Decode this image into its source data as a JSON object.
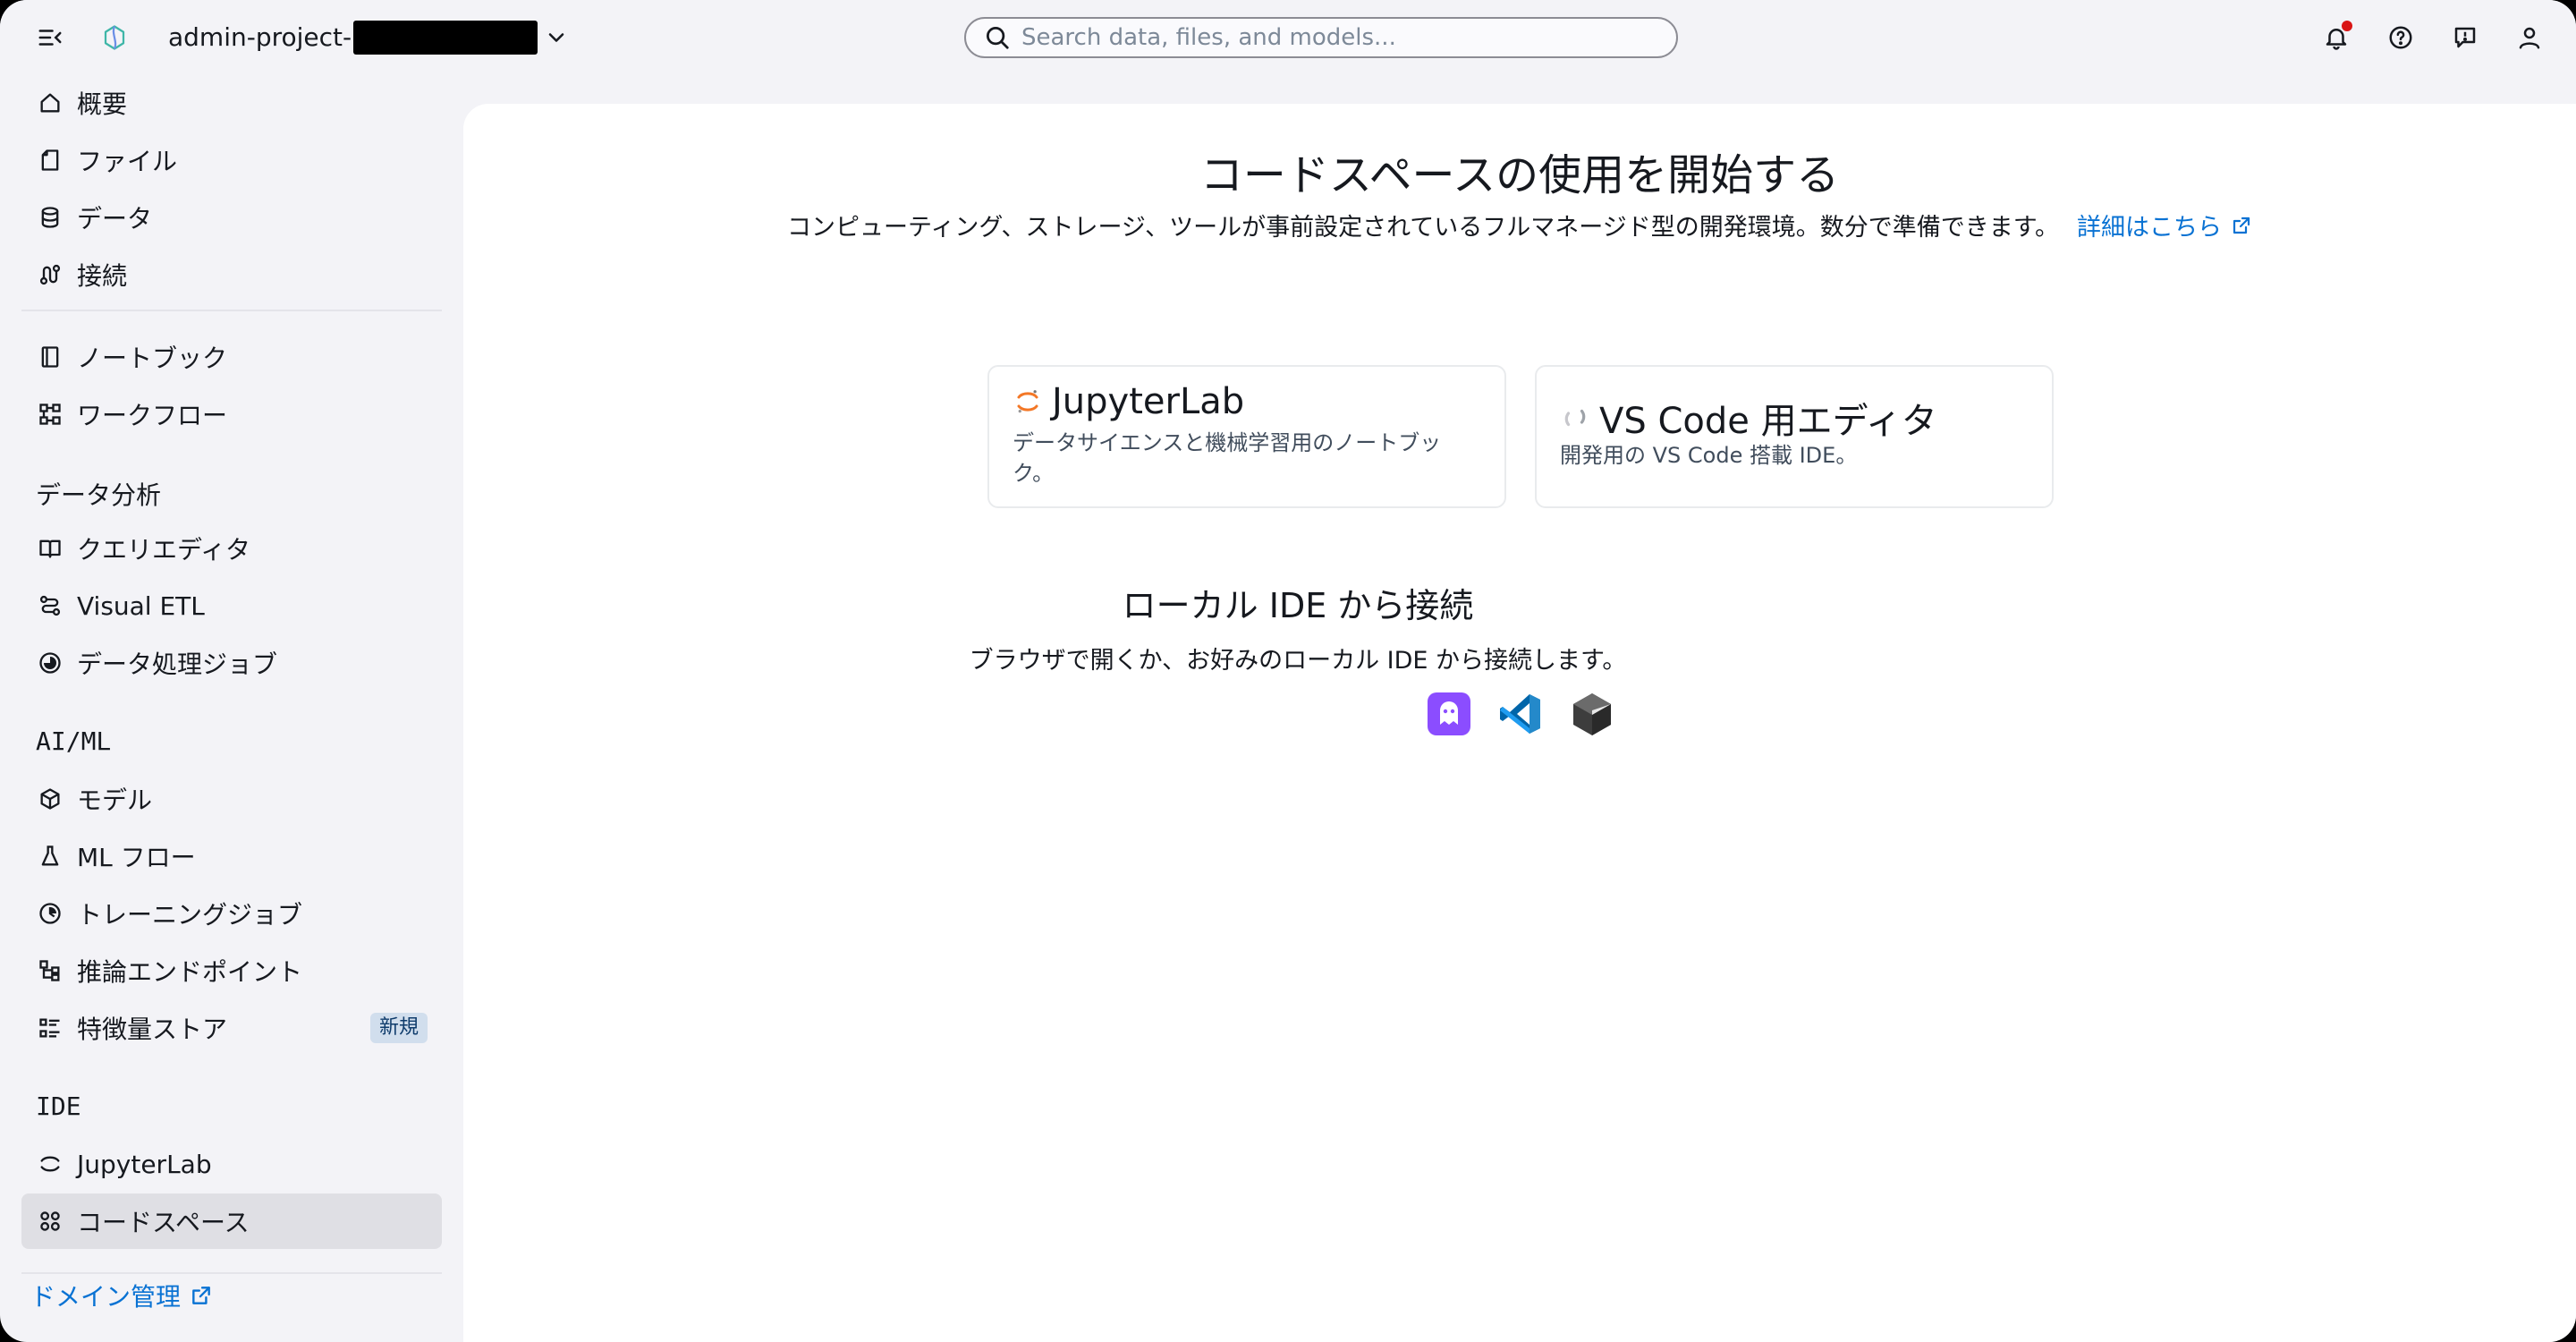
{
  "header": {
    "menu_icon": "collapse-menu-icon",
    "logo_icon": "studio-logo-icon",
    "project_name": "admin-project-",
    "search_placeholder": "Search data, files, and models...",
    "icons": [
      "bell-icon",
      "help-icon",
      "feedback-icon",
      "user-icon"
    ]
  },
  "sidebar": {
    "items_top": [
      {
        "label": "概要",
        "icon": "home-icon"
      },
      {
        "label": "ファイル",
        "icon": "file-icon"
      },
      {
        "label": "データ",
        "icon": "database-icon"
      },
      {
        "label": "接続",
        "icon": "connection-icon"
      }
    ],
    "items_build": [
      {
        "label": "ノートブック",
        "icon": "notebook-icon"
      },
      {
        "label": "ワークフロー",
        "icon": "workflow-icon"
      }
    ],
    "section_analytics": "データ分析",
    "items_analytics": [
      {
        "label": "クエリエディタ",
        "icon": "book-icon"
      },
      {
        "label": "Visual ETL",
        "icon": "etl-icon"
      },
      {
        "label": "データ処理ジョブ",
        "icon": "job-icon"
      }
    ],
    "section_aiml": "AI/ML",
    "items_aiml": [
      {
        "label": "モデル",
        "icon": "cube-icon"
      },
      {
        "label": "ML フロー",
        "icon": "flask-icon"
      },
      {
        "label": "トレーニングジョブ",
        "icon": "clock-icon"
      },
      {
        "label": "推論エンドポイント",
        "icon": "endpoint-icon"
      },
      {
        "label": "特徴量ストア",
        "icon": "list-icon",
        "badge": "新規"
      }
    ],
    "section_ide": "IDE",
    "items_ide": [
      {
        "label": "JupyterLab",
        "icon": "jupyter-icon"
      },
      {
        "label": "コードスペース",
        "icon": "grid-icon",
        "active": true
      }
    ],
    "domain_link": "ドメイン管理"
  },
  "main": {
    "title": "コードスペースの使用を開始する",
    "subtitle": "コンピューティング、ストレージ、ツールが事前設定されているフルマネージド型の開発環境。数分で準備できます。",
    "learn_more": "詳細はこちら",
    "cards": [
      {
        "title": "JupyterLab",
        "desc": "データサイエンスと機械学習用のノートブック。",
        "icon": "jupyter-icon"
      },
      {
        "title": "VS Code 用エディタ",
        "desc": "開発用の VS Code 搭載 IDE。",
        "icon": "loading-icon"
      }
    ],
    "local_title": "ローカル IDE から接続",
    "local_subtitle": "ブラウザで開くか、お好みのローカル IDE から接続します。",
    "local_ides": [
      "kiro-icon",
      "vscode-icon",
      "cursor-icon"
    ]
  },
  "colors": {
    "accent": "#0972d3",
    "background": "#f3f3f7",
    "active_nav": "#dfdfe4",
    "notification": "#d91515"
  }
}
